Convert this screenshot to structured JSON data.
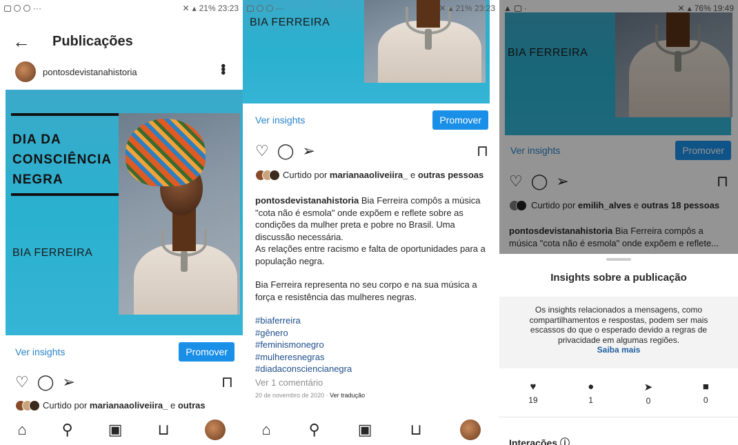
{
  "status1": {
    "left": "···",
    "right": "21% 23:23"
  },
  "status2": {
    "left": "···",
    "right": "21% 23:23"
  },
  "status3": {
    "left": "·",
    "right": "76% 19:49"
  },
  "header": {
    "title": "Publicações"
  },
  "user": {
    "name": "pontosdevistanahistoria"
  },
  "post": {
    "line1": "DIA DA",
    "line2": "CONSCIÊNCIA",
    "line3": "NEGRA",
    "name": "BIA FERREIRA"
  },
  "actions": {
    "view_insights": "Ver insights",
    "promote": "Promover"
  },
  "likes1": {
    "prefix": "Curtido por ",
    "user": "marianaaoliveiira_",
    "mid": " e ",
    "rest": "outras"
  },
  "likes2": {
    "prefix": "Curtido por ",
    "user": "marianaaoliveiira_",
    "mid": " e ",
    "rest": "outras pessoas"
  },
  "likes3": {
    "prefix": "Curtido por ",
    "user": "emilih_alves",
    "mid": " e ",
    "rest": "outras 18 pessoas"
  },
  "caption": {
    "user": "pontosdevistanahistoria",
    "text1": " Bia Ferreira compôs a música \"cota não é  esmola\" onde expõem e reflete sobre as condições da mulher preta e  pobre no Brasil. Uma discussão necessária.",
    "text2": "As relações entre racismo e falta de oportunidades para a população negra.",
    "text3": "Bia Ferreira representa no seu corpo e na sua música a força e resistência das mulheres negras.",
    "short": " Bia Ferreira compôs a música \"cota não é  esmola\" onde expõem e reflete..."
  },
  "hashtags": [
    "#biaferreira",
    "#gênero",
    "#feminismonegro",
    "#mulheresnegras",
    "#diadaconsciencianegra"
  ],
  "comments": "Ver 1 comentário",
  "date": "20 de novembro de 2020 · ",
  "translate": "Ver tradução",
  "sheet": {
    "title": "Insights sobre a publicação",
    "note": "Os insights relacionados a mensagens, como compartilhamentos e respostas, podem ser mais escassos do que o esperado devido a regras de privacidade em algumas regiões.",
    "learn_more": "Saiba mais",
    "stats": [
      {
        "icon": "heart-icon",
        "value": "19"
      },
      {
        "icon": "comment-icon",
        "value": "1"
      },
      {
        "icon": "share-icon",
        "value": "0"
      },
      {
        "icon": "bookmark-icon",
        "value": "0"
      }
    ],
    "interactions": "Interações"
  },
  "colors": {
    "accent": "#1a8fe8",
    "link": "#2a83c9",
    "teal": "#35b4d6"
  }
}
